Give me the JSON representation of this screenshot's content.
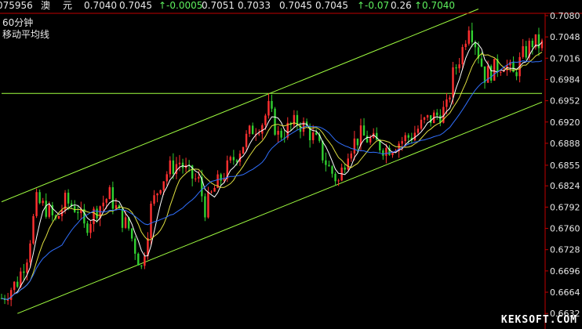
{
  "quote": {
    "code": "075956",
    "name_a": "澳",
    "name_b": "元",
    "open": "0.7040",
    "high_sell": "0.7045",
    "change": "↑-0.0005",
    "p3": "0.7051",
    "p4": "0.7033",
    "p5": "0.7045",
    "p6": "0.7045",
    "pct": "↑-0.07",
    "p7": "0.26",
    "last": "↑0.7040"
  },
  "period_label": "60分钟",
  "indicator_label": "移动平均线",
  "watermark": "KEKSOFT.COM",
  "colors": {
    "up_candle": "#ff3030",
    "down_candle": "#30d030",
    "ma_short": "#ffffff",
    "ma_mid": "#e0e040",
    "ma_long": "#3070ff",
    "trendline": "#a0ff40",
    "axis": "#c00000"
  },
  "chart_data": {
    "type": "candlestick",
    "ylim": [
      0.6632,
      0.7093
    ],
    "y_ticks": [
      "0.7080",
      "0.7048",
      "0.7016",
      "0.6984",
      "0.6952",
      "0.6920",
      "0.6888",
      "0.6855",
      "0.6824",
      "0.6792",
      "0.6760",
      "0.6728",
      "0.6696",
      "0.6664",
      "0.6632"
    ],
    "y_tick_values": [
      0.708,
      0.7048,
      0.7016,
      0.6984,
      0.6952,
      0.692,
      0.6888,
      0.6855,
      0.6824,
      0.6792,
      0.676,
      0.6728,
      0.6696,
      0.6664,
      0.6632
    ],
    "price_path": [
      [
        0,
        0.6655
      ],
      [
        5,
        0.668
      ],
      [
        8,
        0.672
      ],
      [
        11,
        0.68
      ],
      [
        14,
        0.679
      ],
      [
        17,
        0.677
      ],
      [
        20,
        0.68
      ],
      [
        24,
        0.679
      ],
      [
        26,
        0.676
      ],
      [
        30,
        0.679
      ],
      [
        34,
        0.681
      ],
      [
        37,
        0.678
      ],
      [
        40,
        0.676
      ],
      [
        44,
        0.67
      ],
      [
        47,
        0.679
      ],
      [
        50,
        0.683
      ],
      [
        53,
        0.685
      ],
      [
        56,
        0.686
      ],
      [
        59,
        0.684
      ],
      [
        62,
        0.683
      ],
      [
        64,
        0.679
      ],
      [
        67,
        0.682
      ],
      [
        71,
        0.685
      ],
      [
        75,
        0.688
      ],
      [
        79,
        0.691
      ],
      [
        82,
        0.692
      ],
      [
        84,
        0.694
      ],
      [
        87,
        0.69
      ],
      [
        90,
        0.691
      ],
      [
        93,
        0.692
      ],
      [
        96,
        0.691
      ],
      [
        99,
        0.689
      ],
      [
        103,
        0.685
      ],
      [
        106,
        0.683
      ],
      [
        109,
        0.688
      ],
      [
        113,
        0.69
      ],
      [
        117,
        0.689
      ],
      [
        121,
        0.688
      ],
      [
        125,
        0.689
      ],
      [
        129,
        0.69
      ],
      [
        133,
        0.692
      ],
      [
        137,
        0.693
      ],
      [
        140,
        0.694
      ],
      [
        142,
        0.699
      ],
      [
        145,
        0.703
      ],
      [
        147,
        0.707
      ],
      [
        149,
        0.704
      ],
      [
        152,
        0.699
      ],
      [
        155,
        0.7
      ],
      [
        158,
        0.701
      ],
      [
        161,
        0.699
      ],
      [
        164,
        0.702
      ],
      [
        167,
        0.704
      ],
      [
        170,
        0.7035
      ]
    ],
    "trendlines": [
      {
        "name": "upper-channel",
        "points": [
          [
            0,
            0.68
          ],
          [
            150,
            0.709
          ]
        ]
      },
      {
        "name": "lower-channel",
        "points": [
          [
            5,
            0.6632
          ],
          [
            170,
            0.695
          ]
        ]
      },
      {
        "name": "horizontal-level",
        "points": [
          [
            0,
            0.6963
          ],
          [
            170,
            0.6963
          ]
        ]
      }
    ],
    "moving_averages": [
      {
        "name": "ma_short",
        "period": 5
      },
      {
        "name": "ma_mid",
        "period": 10
      },
      {
        "name": "ma_long",
        "period": 20
      }
    ]
  }
}
